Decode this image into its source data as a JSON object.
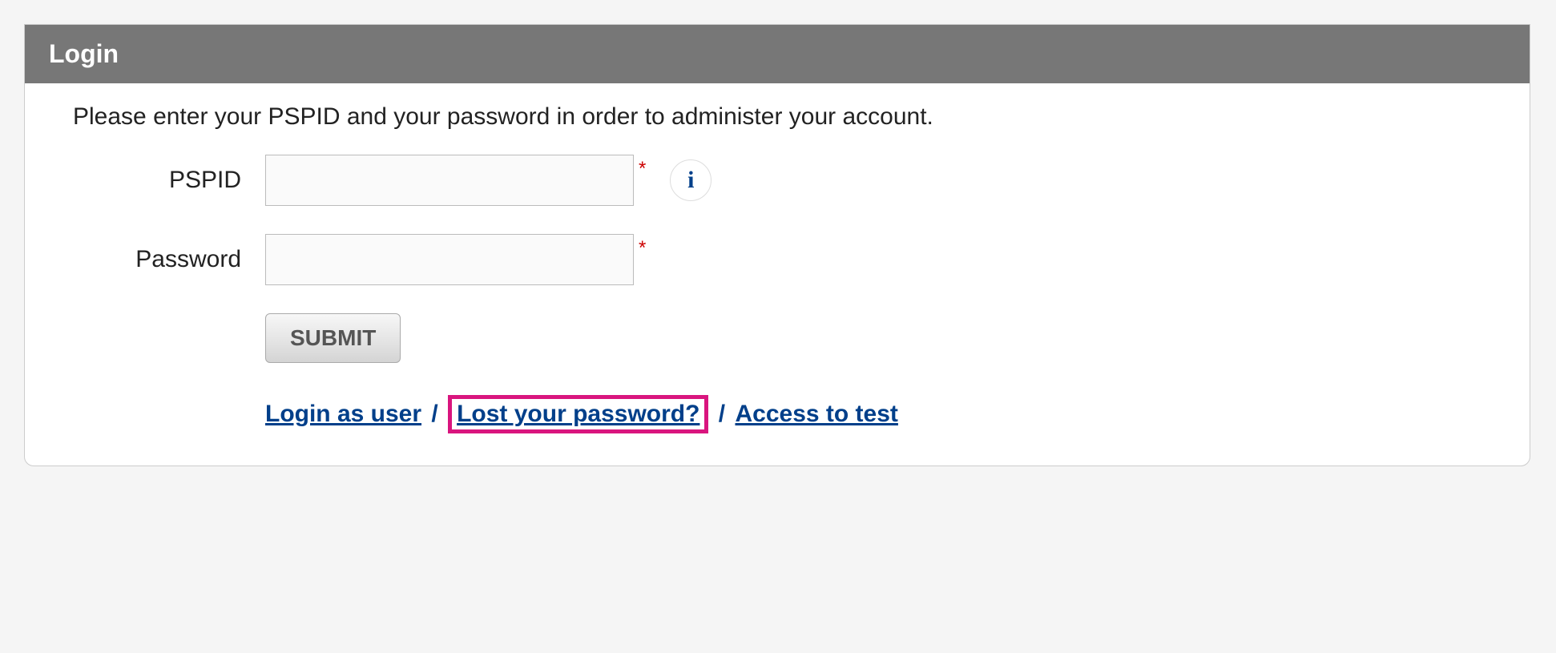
{
  "panel": {
    "title": "Login",
    "instruction": "Please enter your PSPID and your password in order to administer your account."
  },
  "form": {
    "pspid_label": "PSPID",
    "pspid_value": "",
    "password_label": "Password",
    "password_value": "",
    "required_mark": "*",
    "info_glyph": "i",
    "submit_label": "SUBMIT"
  },
  "links": {
    "login_as_user": "Login as user",
    "lost_password": "Lost your password?",
    "access_to_test": "Access to test",
    "separator": "/"
  }
}
